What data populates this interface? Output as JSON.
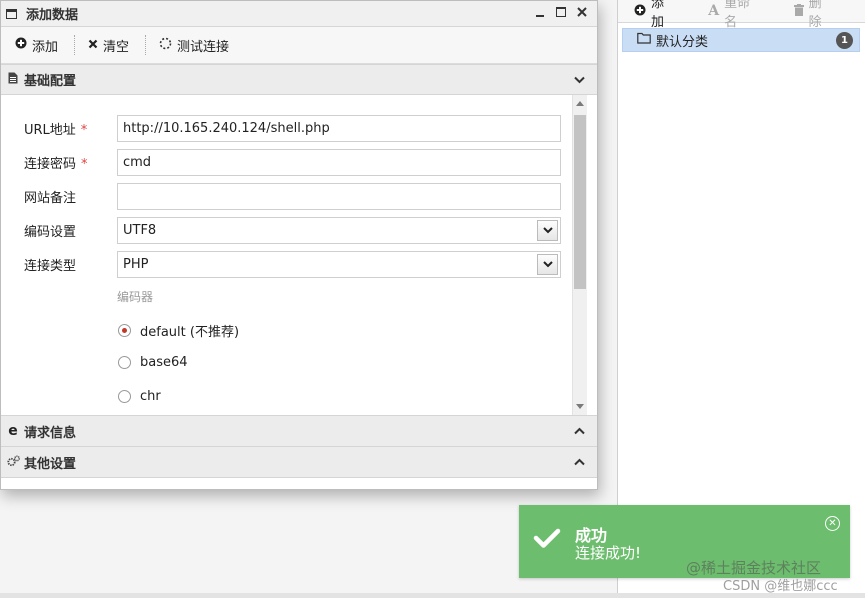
{
  "dialog": {
    "title": "添加数据",
    "toolbar": {
      "add_label": "添加",
      "clear_label": "清空",
      "test_label": "测试连接"
    },
    "sections": {
      "basic": "基础配置",
      "request": "请求信息",
      "other": "其他设置"
    },
    "form": {
      "url_label": "URL地址",
      "url_value": "http://10.165.240.124/shell.php",
      "password_label": "连接密码",
      "password_value": "cmd",
      "note_label": "网站备注",
      "note_value": "",
      "encoding_label": "编码设置",
      "encoding_value": "UTF8",
      "type_label": "连接类型",
      "type_value": "PHP",
      "encoder_title": "编码器",
      "encoders": [
        {
          "label": "default (不推荐)",
          "checked": true
        },
        {
          "label": "base64",
          "checked": false
        },
        {
          "label": "chr",
          "checked": false
        }
      ],
      "required_mark": "*"
    }
  },
  "category_panel": {
    "add_label": "添加",
    "rename_label": "重命名",
    "delete_label": "删除",
    "item_label": "默认分类",
    "item_count": "1",
    "selected_color": "#c9def5"
  },
  "toast": {
    "title": "成功",
    "message": "连接成功!",
    "color": "#6dbd6e"
  },
  "watermarks": {
    "line1": "@稀土掘金技术社区",
    "line2": "CSDN @维也娜ccc"
  }
}
